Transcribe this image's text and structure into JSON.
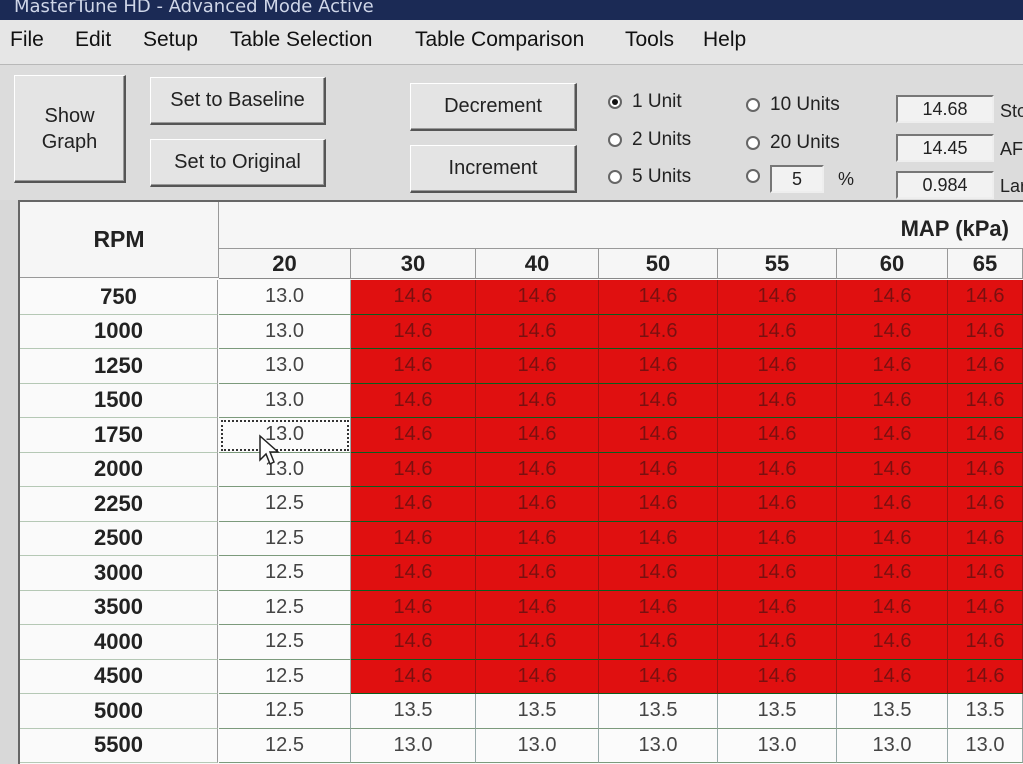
{
  "window": {
    "title": "MasterTune HD - Advanced Mode Active"
  },
  "menu": [
    "File",
    "Edit",
    "Setup",
    "Table Selection",
    "Table Comparison",
    "Tools",
    "Help"
  ],
  "buttons": {
    "show_graph": "Show Graph",
    "set_baseline": "Set to Baseline",
    "set_original": "Set to Original",
    "decrement": "Decrement",
    "increment": "Increment"
  },
  "step_options": {
    "selected": "1 Unit",
    "items": [
      "1 Unit",
      "2 Units",
      "5 Units",
      "10 Units",
      "20 Units"
    ],
    "percent_value": "5",
    "percent_symbol": "%"
  },
  "readouts": [
    {
      "value": "14.68",
      "label": "Sto"
    },
    {
      "value": "14.45",
      "label": "AFI"
    },
    {
      "value": "0.984",
      "label": "Lar"
    }
  ],
  "table": {
    "row_header": "RPM",
    "col_header": "MAP (kPa)",
    "columns": [
      "20",
      "30",
      "40",
      "50",
      "55",
      "60",
      "65"
    ],
    "rows": [
      {
        "rpm": "750",
        "cells": [
          "13.0",
          "14.6",
          "14.6",
          "14.6",
          "14.6",
          "14.6",
          "14.6"
        ]
      },
      {
        "rpm": "1000",
        "cells": [
          "13.0",
          "14.6",
          "14.6",
          "14.6",
          "14.6",
          "14.6",
          "14.6"
        ]
      },
      {
        "rpm": "1250",
        "cells": [
          "13.0",
          "14.6",
          "14.6",
          "14.6",
          "14.6",
          "14.6",
          "14.6"
        ]
      },
      {
        "rpm": "1500",
        "cells": [
          "13.0",
          "14.6",
          "14.6",
          "14.6",
          "14.6",
          "14.6",
          "14.6"
        ]
      },
      {
        "rpm": "1750",
        "cells": [
          "13.0",
          "14.6",
          "14.6",
          "14.6",
          "14.6",
          "14.6",
          "14.6"
        ]
      },
      {
        "rpm": "2000",
        "cells": [
          "13.0",
          "14.6",
          "14.6",
          "14.6",
          "14.6",
          "14.6",
          "14.6"
        ]
      },
      {
        "rpm": "2250",
        "cells": [
          "12.5",
          "14.6",
          "14.6",
          "14.6",
          "14.6",
          "14.6",
          "14.6"
        ]
      },
      {
        "rpm": "2500",
        "cells": [
          "12.5",
          "14.6",
          "14.6",
          "14.6",
          "14.6",
          "14.6",
          "14.6"
        ]
      },
      {
        "rpm": "3000",
        "cells": [
          "12.5",
          "14.6",
          "14.6",
          "14.6",
          "14.6",
          "14.6",
          "14.6"
        ]
      },
      {
        "rpm": "3500",
        "cells": [
          "12.5",
          "14.6",
          "14.6",
          "14.6",
          "14.6",
          "14.6",
          "14.6"
        ]
      },
      {
        "rpm": "4000",
        "cells": [
          "12.5",
          "14.6",
          "14.6",
          "14.6",
          "14.6",
          "14.6",
          "14.6"
        ]
      },
      {
        "rpm": "4500",
        "cells": [
          "12.5",
          "14.6",
          "14.6",
          "14.6",
          "14.6",
          "14.6",
          "14.6"
        ]
      },
      {
        "rpm": "5000",
        "cells": [
          "12.5",
          "13.5",
          "13.5",
          "13.5",
          "13.5",
          "13.5",
          "13.5"
        ]
      },
      {
        "rpm": "5500",
        "cells": [
          "12.5",
          "13.0",
          "13.0",
          "13.0",
          "13.0",
          "13.0",
          "13.0"
        ]
      }
    ],
    "selected_cell": {
      "row": 4,
      "col": 0
    },
    "highlight_color": "#e01010"
  }
}
